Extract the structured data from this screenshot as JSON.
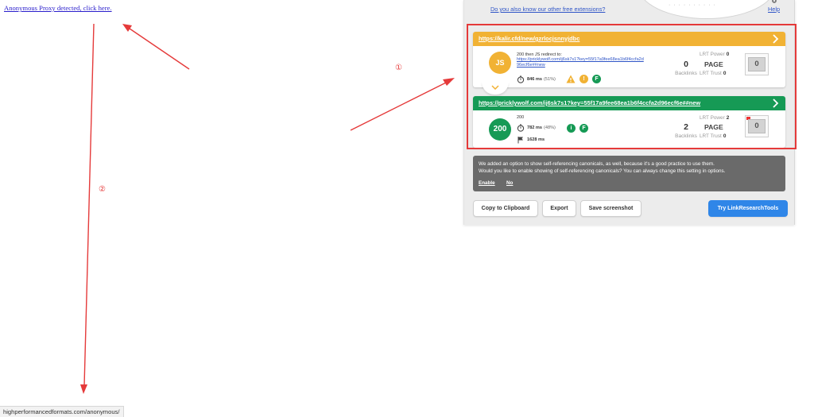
{
  "page": {
    "proxy_link": "Anonymous Proxy detected, click here.",
    "status_bar_url": "highperformancedformats.com/anonymous/"
  },
  "extension": {
    "other_extensions_link": "Do you also know our other free extensions?",
    "help_link": "Help",
    "cards": [
      {
        "url": "https://kalir.cfd/new/gzrlocjsnnyjdbc",
        "badge": "JS",
        "status_text": "200 then JS redirect to:",
        "redirect_url_line1": "https://pricklywolf.com/ij6sk7s1?key=55f17a9fee68ea1b6f4ccfa2d",
        "redirect_url_line2": "96ecf6e##new",
        "timing_ms": "846 ms",
        "timing_pct": "(51%)",
        "icons": [
          "warning-icon",
          "info-icon",
          "follow-icon"
        ],
        "info_glyph": "!",
        "follow_glyph": "F",
        "backlinks": "0",
        "backlinks_label": "Backlinks",
        "lrt_power_label": "LRT Power",
        "lrt_power": "0",
        "page_label": "PAGE",
        "lrt_trust_label": "LRT Trust",
        "lrt_trust": "0",
        "gauge_value": "0",
        "gauge_fill": 0
      },
      {
        "url": "https://pricklywolf.com/ij6sk7s1?key=55f17a9fee68ea1b6f4ccfa2d96ecf6e##new",
        "badge": "200",
        "status_text": "200",
        "timing_ms": "782 ms",
        "timing_pct": "(48%)",
        "load_ms": "1628 ms",
        "icons": [
          "info-icon",
          "follow-icon"
        ],
        "info_glyph": "i",
        "follow_glyph": "F",
        "backlinks": "2",
        "backlinks_label": "Backlinks",
        "lrt_power_label": "LRT Power",
        "lrt_power": "2",
        "page_label": "PAGE",
        "lrt_trust_label": "LRT Trust",
        "lrt_trust": "0",
        "gauge_value": "0",
        "gauge_fill": 0.2
      }
    ],
    "notice": {
      "line1": "We added an option to show self-referencing canonicals, as well, because it's a good practice to use them.",
      "line2": "Would you like to enable showing of self-referencing canonicals? You can always change this setting in options.",
      "enable": "Enable",
      "no": "No"
    },
    "buttons": {
      "copy": "Copy to Clipboard",
      "export": "Export",
      "screenshot": "Save screenshot",
      "try": "Try LinkResearchTools"
    }
  },
  "annotations": {
    "label_1": "①",
    "label_2": "②",
    "color": "#e53a3a"
  },
  "colors": {
    "redirect_header": "#f1b234",
    "ok_header": "#169a55",
    "link": "#2f55c7",
    "primary_button": "#2f86e8"
  }
}
